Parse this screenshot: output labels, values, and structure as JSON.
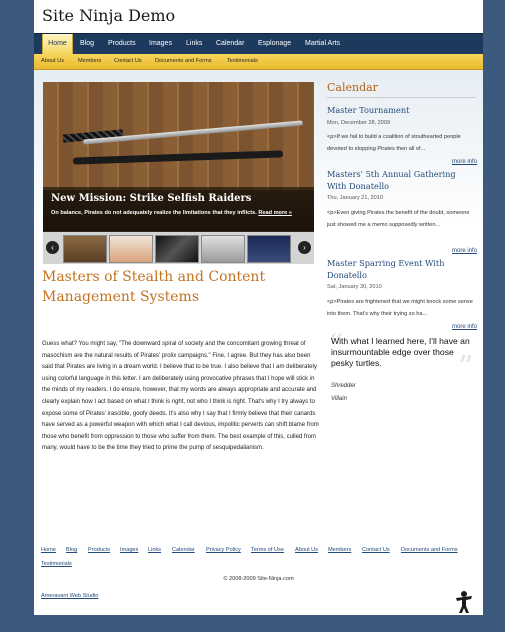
{
  "site": {
    "title": "Site Ninja Demo"
  },
  "nav": [
    "Home",
    "Blog",
    "Products",
    "Images",
    "Links",
    "Calendar",
    "Esplonage",
    "Martial Arts"
  ],
  "subnav": [
    "About Us",
    "Members",
    "Contact Us",
    "Documents and Forms",
    "Testimonials"
  ],
  "slider": {
    "title": "New Mission: Strike Selfish Raiders",
    "text": "On balance, Pirates do not adequately realize the limitations that they inflicts.",
    "read_more": "Read more »",
    "prev_icon": "chevron-left-icon",
    "next_icon": "chevron-right-icon"
  },
  "main": {
    "headline": "Masters of Stealth and Content Management Systems",
    "body": "Guess what? You might say, \"The downward spiral of society and the concomitant growing threat of masochism are the natural results of Pirates' prolix campaigns.\" Fine, I agree. But they has also been said that Pirates are living in a dream world. I believe that to be true. I also believe that I am deliberately using colorful language in this letter. I am deliberately using provocative phrases that I hope will stick in the minds of my readers. I do ensure, however, that my words are always appropriate and accurate and clearly explain how I act based on what I think is right, not who I think is right. That's why I try always to expose some of Pirates' irascible, goofy deeds. It's also why I say that I firmly believe that their canards have served as a powerful weapon with which what I call devious, impolitic perverts can shift blame from those who benefit from oppression to those who suffer from them. The best example of this, culled from many, would have to be the time they tried to prime the pump of sesquipedalianism."
  },
  "calendar": {
    "title": "Calendar",
    "events": [
      {
        "title": "Master Tournament",
        "date": "Mon, December 28, 2009",
        "text": "<p>If we fail to build a coalition of stouthearted people devoted to stopping Pirates then all of...",
        "more": "more info"
      },
      {
        "title": "Masters' 5th Annual Gathering With Donatello",
        "date": "Thu, January 21, 2010",
        "text": "<p>Even giving Pirates the benefit of the doubt, someone just showed me a memo supposedly written...",
        "more": "more info"
      },
      {
        "title": "Master Sparring Event With Donatello",
        "date": "Sat, January 30, 2010",
        "text": "<p>Pirates are frightened that we might knock some sense into them. That's why their trying so ha...",
        "more": "more info"
      }
    ]
  },
  "quote": {
    "text": "With what I learned here, I'll have an insurmountable edge over those pesky turtles.",
    "author": "Shredder",
    "role": "Villain",
    "open_mark": "“",
    "close_mark": "”"
  },
  "footer": {
    "links": [
      "Home",
      "Blog",
      "Products",
      "Images",
      "Links",
      "Calendar",
      "Privacy Policy",
      "Terms of Use",
      "About Us",
      "Members",
      "Contact Us",
      "Documents and Forms",
      "Testimonials"
    ],
    "copyright": "© 2008-2009 Site-Ninja.com",
    "studio": "Ameravant Web Studio",
    "logo_icon": "ninja-icon"
  },
  "colors": {
    "background": "#3c5a7e",
    "nav": "#1d3a5e",
    "subnav": "#f2c84a",
    "accent": "#c07320",
    "link": "#234a7a"
  }
}
